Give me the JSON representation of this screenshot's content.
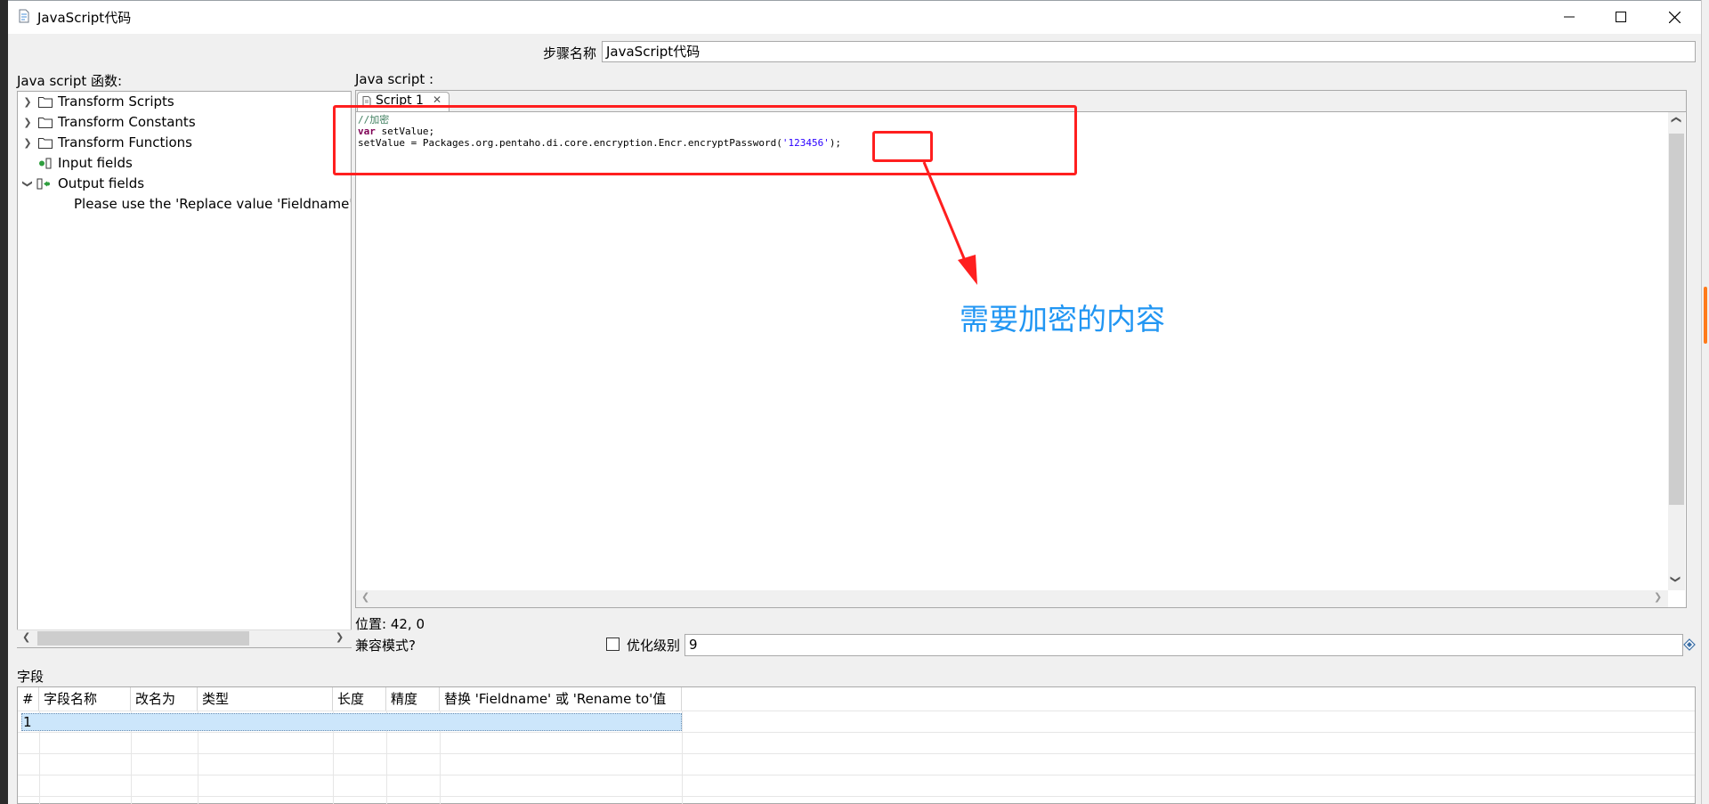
{
  "window": {
    "title": "JavaScript代码"
  },
  "step": {
    "label": "步骤名称",
    "value": "JavaScript代码"
  },
  "functions_panel": {
    "label": "Java script 函数:",
    "tree": [
      {
        "label": "Transform Scripts",
        "expanded": false,
        "icon": "folder-icon"
      },
      {
        "label": "Transform Constants",
        "expanded": false,
        "icon": "folder-icon"
      },
      {
        "label": "Transform Functions",
        "expanded": false,
        "icon": "folder-icon"
      },
      {
        "label": "Input fields",
        "icon": "input-fields-icon"
      },
      {
        "label": "Output fields",
        "expanded": true,
        "icon": "output-fields-icon"
      }
    ],
    "output_hint": "Please use the 'Replace value 'Fieldname' o"
  },
  "editor": {
    "label": "Java script :",
    "tab_label": "Script 1",
    "code": {
      "line1": "//加密",
      "line2_keyword": "var",
      "line2_rest": " setValue;",
      "line3_before": "setValue = Packages.org.pentaho.di.core.encryption.Encr.encryptPassword(",
      "line3_string": "'123456'",
      "line3_after": ");"
    },
    "position_text": "位置: 42, 0",
    "compat_label": "兼容模式?",
    "opt_label": "优化级别",
    "opt_value": "9"
  },
  "annotation": {
    "text": "需要加密的内容",
    "color": "#ff1f1f",
    "text_color": "#2196f3"
  },
  "fields": {
    "label": "字段",
    "columns": [
      "#",
      "字段名称",
      "改名为",
      "类型",
      "长度",
      "精度",
      "替换 'Fieldname' 或 'Rename to'值"
    ],
    "rows": [
      [
        "1",
        "",
        "",
        "",
        "",
        "",
        ""
      ]
    ]
  }
}
